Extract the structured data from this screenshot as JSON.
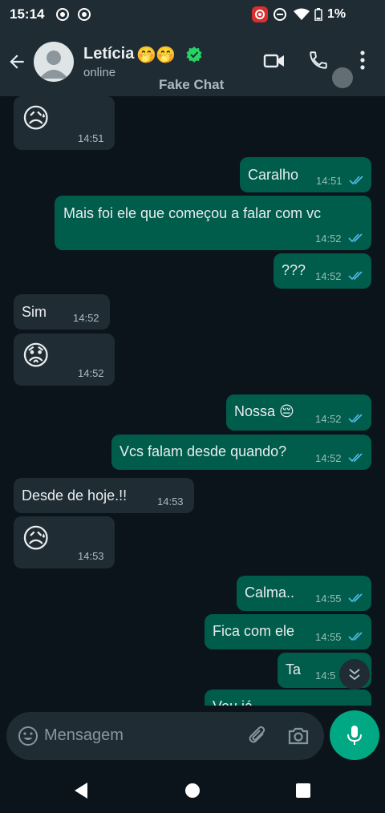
{
  "status_bar": {
    "time": "15:14",
    "battery": "1%"
  },
  "header": {
    "contact_name": "Letícia",
    "name_emojis": [
      "🤭",
      "🤭"
    ],
    "status": "online",
    "watermark": "Fake Chat",
    "icons": [
      "back-arrow-icon",
      "avatar",
      "verified-icon",
      "video-call-icon",
      "voice-call-icon",
      "more-options-icon"
    ]
  },
  "messages": [
    {
      "dir": "in",
      "emoji": "😥",
      "time": "14:51"
    },
    {
      "dir": "out",
      "text": "Caralho",
      "time": "14:51",
      "read": true
    },
    {
      "dir": "out",
      "text": "Mais foi ele que começou a falar com vc",
      "time": "14:52",
      "read": true
    },
    {
      "dir": "out",
      "text": "???",
      "time": "14:52",
      "read": true
    },
    {
      "dir": "in",
      "text": "Sim",
      "time": "14:52"
    },
    {
      "dir": "in",
      "emoji": "😟",
      "time": "14:52"
    },
    {
      "dir": "out",
      "text": "Nossa 😔",
      "time": "14:52",
      "read": true
    },
    {
      "dir": "out",
      "text": "Vcs falam desde quando?",
      "time": "14:52",
      "read": true
    },
    {
      "dir": "in",
      "text": "Desde de hoje.!!",
      "time": "14:53"
    },
    {
      "dir": "in",
      "emoji": "😥",
      "time": "14:53"
    },
    {
      "dir": "out",
      "text": "Calma..",
      "time": "14:55",
      "read": true
    },
    {
      "dir": "out",
      "text": "Fica com ele",
      "time": "14:55",
      "read": true
    },
    {
      "dir": "out",
      "text": "Ta",
      "time": "14:5",
      "read": true
    },
    {
      "dir": "out",
      "text": "Vou já",
      "time": "",
      "read": true
    }
  ],
  "composer": {
    "placeholder": "Mensagem"
  },
  "colors": {
    "background": "#0b141a",
    "incoming_bubble": "#1f2c34",
    "outgoing_bubble": "#005c4b",
    "accent": "#00a884",
    "read_tick": "#53bdeb"
  }
}
